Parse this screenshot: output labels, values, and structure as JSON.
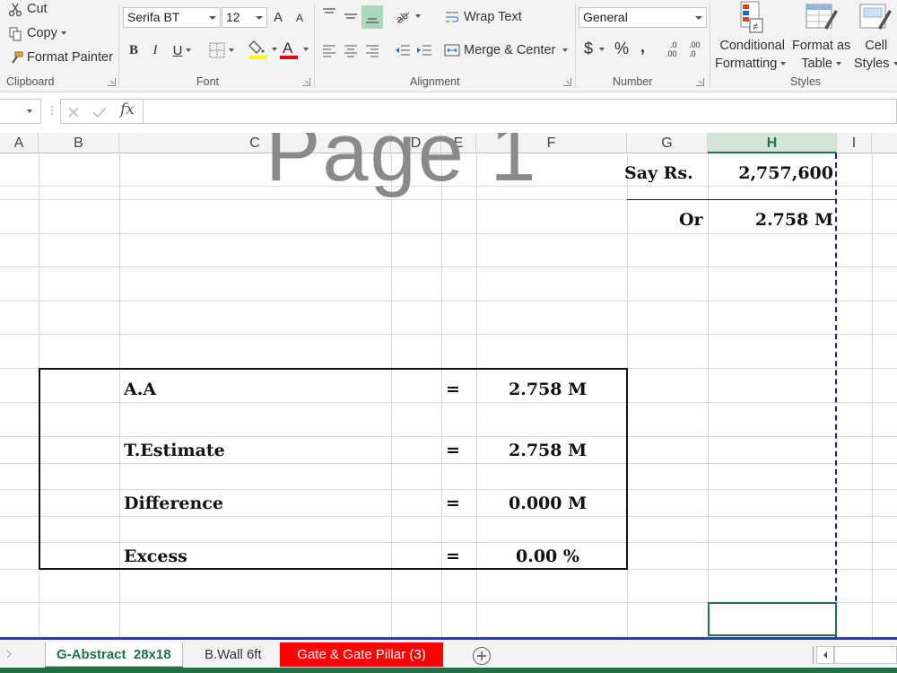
{
  "clipboard": {
    "cut": "Cut",
    "copy": "Copy",
    "format_painter": "Format Painter",
    "label": "Clipboard"
  },
  "font": {
    "name": "Serifa BT",
    "size": "12",
    "bold": "B",
    "italic": "I",
    "underline": "U",
    "grow": "A",
    "shrink": "A",
    "label": "Font"
  },
  "alignment": {
    "wrap_text": "Wrap Text",
    "merge_center": "Merge & Center",
    "label": "Alignment"
  },
  "number": {
    "format": "General",
    "currency": "$",
    "percent": "%",
    "comma": ",",
    "inc_decimal_top": ".0",
    "inc_decimal_bottom": ".00",
    "dec_decimal_top": ".00",
    "dec_decimal_bottom": ".0",
    "label": "Number"
  },
  "styles": {
    "conditional_line1": "Conditional",
    "conditional_line2": "Formatting",
    "format_table_line1": "Format as",
    "format_table_line2": "Table",
    "cell_styles_line1": "Cell",
    "cell_styles_line2": "Styles",
    "label": "Styles"
  },
  "formula_bar": {
    "fx": "fx",
    "value": ""
  },
  "columns": [
    "A",
    "B",
    "C",
    "D",
    "E",
    "F",
    "G",
    "H",
    "I"
  ],
  "watermark": "Page 1",
  "cells": {
    "say_rs_label": "Say Rs.",
    "say_rs_value": "2,757,600",
    "or_label": "Or",
    "or_value": "2.758 M"
  },
  "summary": [
    {
      "label": "A.A",
      "eq": "=",
      "value": "2.758 M"
    },
    {
      "label": "T.Estimate",
      "eq": "=",
      "value": "2.758 M"
    },
    {
      "label": "Difference",
      "eq": "=",
      "value": "0.000 M"
    },
    {
      "label": "Excess",
      "eq": "=",
      "value": "0.00 %"
    }
  ],
  "sheets": [
    {
      "name": "G-Abstract  28x18",
      "active": true
    },
    {
      "name": "B.Wall 6ft",
      "active": false
    },
    {
      "name": "Gate & Gate Pillar (3)",
      "active": false,
      "color": "#ff0000"
    }
  ],
  "colors": {
    "accent": "#217346",
    "page_break": "#1f1f9e",
    "tab_red": "#ff0000",
    "highlight": "#a9d8bb"
  }
}
